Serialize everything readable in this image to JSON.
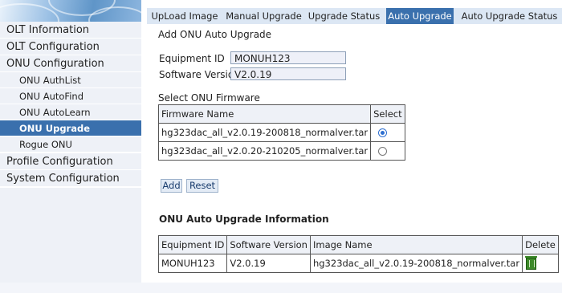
{
  "sidebar": {
    "top_items": [
      "OLT Information",
      "OLT Configuration",
      "ONU Configuration"
    ],
    "sub_items": [
      "ONU AuthList",
      "ONU AutoFind",
      "ONU AutoLearn",
      "ONU Upgrade",
      "Rogue ONU"
    ],
    "active_sub": "ONU Upgrade",
    "bottom_items": [
      "Profile Configuration",
      "System Configuration"
    ]
  },
  "tabs": [
    "UpLoad Image",
    "Manual Upgrade",
    "Upgrade Status",
    "Auto Upgrade",
    "Auto Upgrade Status"
  ],
  "active_tab": "Auto Upgrade",
  "form": {
    "title": "Add ONU Auto Upgrade",
    "equipment_id_label": "Equipment ID",
    "equipment_id_value": "MONUH123",
    "software_version_label": "Software Version",
    "software_version_value": "V2.0.19"
  },
  "firmware": {
    "section_label": "Select ONU Firmware",
    "headers": [
      "Firmware Name",
      "Select"
    ],
    "rows": [
      {
        "name": "hg323dac_all_v2.0.19-200818_normalver.tar",
        "selected": true
      },
      {
        "name": "hg323dac_all_v2.0.20-210205_normalver.tar",
        "selected": false
      }
    ]
  },
  "buttons": {
    "add": "Add",
    "reset": "Reset"
  },
  "info": {
    "title": "ONU Auto Upgrade Information",
    "headers": [
      "Equipment ID",
      "Software Version",
      "Image Name",
      "Delete"
    ],
    "rows": [
      {
        "equipment_id": "MONUH123",
        "software_version": "V2.0.19",
        "image_name": "hg323dac_all_v2.0.19-200818_normalver.tar",
        "delete_icon": "trash-icon"
      }
    ]
  },
  "colors": {
    "accent": "#3a70ad",
    "menu_bg": "#eef1f7",
    "tab_bar_bg": "#dce7f4"
  }
}
